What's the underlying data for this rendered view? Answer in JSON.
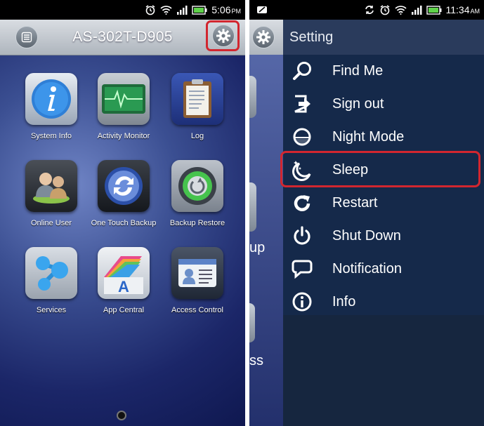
{
  "left_screen": {
    "status_bar": {
      "time": "5:06",
      "ampm": "PM"
    },
    "title": "AS-302T-D905",
    "apps": [
      {
        "label": "System Info",
        "icon": "info-icon"
      },
      {
        "label": "Activity Monitor",
        "icon": "heartbeat-monitor-icon"
      },
      {
        "label": "Log",
        "icon": "clipboard-log-icon"
      },
      {
        "label": "Online User",
        "icon": "users-icon"
      },
      {
        "label": "One Touch Backup",
        "icon": "sync-icon"
      },
      {
        "label": "Backup Restore",
        "icon": "restore-icon"
      },
      {
        "label": "Services",
        "icon": "services-molecule-icon"
      },
      {
        "label": "App Central",
        "icon": "app-central-icon"
      },
      {
        "label": "Access Control",
        "icon": "id-card-icon"
      }
    ]
  },
  "right_screen": {
    "status_bar": {
      "time": "11:34",
      "ampm": "AM"
    },
    "peek_text": {
      "a": "up",
      "b": "ss"
    },
    "menu_title": "Setting",
    "menu_items": [
      {
        "label": "Find Me",
        "icon": "search-icon"
      },
      {
        "label": "Sign out",
        "icon": "sign-out-icon"
      },
      {
        "label": "Night Mode",
        "icon": "night-mode-icon"
      },
      {
        "label": "Sleep",
        "icon": "sleep-moon-icon"
      },
      {
        "label": "Restart",
        "icon": "restart-icon"
      },
      {
        "label": "Shut Down",
        "icon": "power-icon"
      },
      {
        "label": "Notification",
        "icon": "speech-bubble-icon"
      },
      {
        "label": "Info",
        "icon": "info-circle-icon"
      }
    ],
    "highlighted_item": "Sleep"
  },
  "colors": {
    "highlight_red": "#d2262f",
    "menu_bg": "#15294a",
    "menu_header": "#2a3b5c"
  }
}
